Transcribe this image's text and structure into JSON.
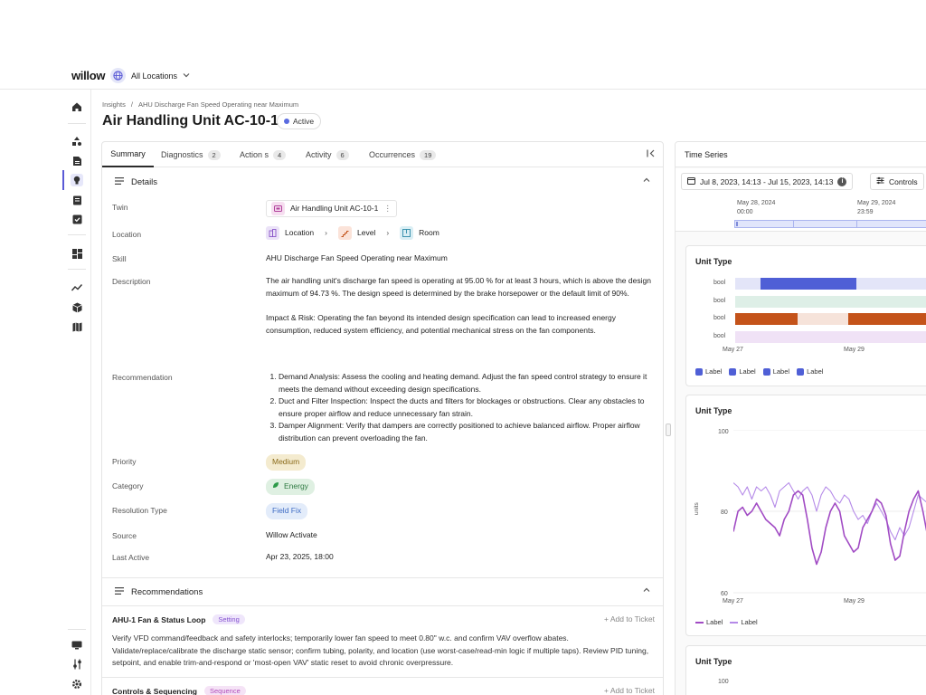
{
  "app": {
    "logo": "willow",
    "location_selector": "All Locations"
  },
  "breadcrumb": {
    "parent": "Insights",
    "separator": "/",
    "current": "AHU Discharge Fan Speed Operating near Maximum"
  },
  "page": {
    "title": "Air Handling Unit AC-10-1",
    "status": "Active"
  },
  "tabs": [
    {
      "label": "Summary",
      "count": ""
    },
    {
      "label": "Diagnostics",
      "count": "2"
    },
    {
      "label": "Action s",
      "count": "4"
    },
    {
      "label": "Activity",
      "count": "6"
    },
    {
      "label": "Occurrences",
      "count": "19"
    }
  ],
  "details": {
    "heading": "Details",
    "twin_label": "Twin",
    "twin_value": "Air Handling Unit AC-10-1",
    "location_label": "Location",
    "location_path": [
      "Location",
      "Level",
      "Room"
    ],
    "skill_label": "Skill",
    "skill_value": "AHU Discharge Fan Speed Operating near Maximum",
    "description_label": "Description",
    "description_p1": "The air handling unit's discharge fan speed is operating at 95.00 % for at least 3 hours, which is above the design maximum of 94.73 %. The design speed is determined by the brake horsepower or the default limit of 90%.",
    "description_p2": "Impact & Risk: Operating the fan beyond its intended design specification can lead to increased energy consumption, reduced system efficiency, and potential mechanical stress on the fan components.",
    "recommendation_label": "Recommendation",
    "recommendation_items": [
      "Demand Analysis: Assess the cooling and heating demand. Adjust the fan speed control strategy to ensure it meets the demand without exceeding design specifications.",
      "Duct and Filter Inspection: Inspect the ducts and filters for blockages or obstructions. Clear any obstacles to ensure proper airflow and reduce unnecessary fan strain.",
      "Damper Alignment: Verify that dampers are correctly positioned to achieve balanced airflow. Proper airflow distribution can prevent overloading the fan."
    ],
    "priority_label": "Priority",
    "priority_value": "Medium",
    "category_label": "Category",
    "category_value": "Energy",
    "resolution_label": "Resolution Type",
    "resolution_value": "Field Fix",
    "source_label": "Source",
    "source_value": "Willow Activate",
    "last_active_label": "Last Active",
    "last_active_value": "Apr 23, 2025, 18:00"
  },
  "recommendations": {
    "heading": "Recommendations",
    "items": [
      {
        "title": "AHU-1 Fan & Status Loop",
        "tag": "Setting",
        "action": "Add to Ticket",
        "body": "Verify VFD command/feedback and safety interlocks; temporarily lower fan speed to meet 0.80\" w.c. and confirm VAV overflow abates. Validate/replace/calibrate the discharge static sensor; confirm tubing, polarity, and location (use worst-case/read-min logic if multiple taps). Review PID tuning, setpoint, and enable trim-and-respond or 'most-open VAV' static reset to avoid chronic overpressure."
      },
      {
        "title": "Controls & Sequencing",
        "tag": "Sequence",
        "action": "Add to Ticket",
        "body": ""
      }
    ]
  },
  "time_series": {
    "heading": "Time Series",
    "date_range": "Jul 8, 2023, 14:13 - Jul 15, 2023, 14:13",
    "controls_label": "Controls",
    "overview_ticks": [
      {
        "date": "May 28, 2024",
        "time": "00:00"
      },
      {
        "date": "May 29, 2024",
        "time": "23:59"
      }
    ]
  },
  "colors": {
    "accent": "#5a5ad6",
    "blue_series": "#4f5fd6",
    "orange_series": "#c4531a",
    "purple_series": "#a14bc4",
    "lilac_series": "#b58ae8"
  },
  "chart_data": [
    {
      "type": "bool-timeline",
      "title": "Unit Type",
      "rows": [
        {
          "label": "bool",
          "segments": [
            [
              0,
              0.12,
              "off"
            ],
            [
              0.12,
              0.58,
              "on"
            ],
            [
              0.58,
              1,
              "off"
            ]
          ],
          "color": "#4f5fd6"
        },
        {
          "label": "bool",
          "segments": [
            [
              0,
              1,
              "off"
            ]
          ],
          "color": "#2e9a6a"
        },
        {
          "label": "bool",
          "segments": [
            [
              0,
              0.3,
              "on"
            ],
            [
              0.3,
              0.54,
              "off"
            ],
            [
              0.54,
              1,
              "on"
            ]
          ],
          "color": "#c4531a"
        },
        {
          "label": "bool",
          "segments": [
            [
              0,
              1,
              "off"
            ]
          ],
          "color": "#a14bc4"
        }
      ],
      "x_ticks": [
        "May 27",
        "May 29"
      ],
      "legend": [
        "Label",
        "Label",
        "Label",
        "Label"
      ]
    },
    {
      "type": "line",
      "title": "Unit Type",
      "ylabel": "units",
      "ylim": [
        60,
        100
      ],
      "y_ticks": [
        100,
        80,
        60
      ],
      "x_ticks": [
        "May 27",
        "May 29"
      ],
      "series": [
        {
          "name": "Label",
          "color": "#a14bc4",
          "values": [
            75,
            80,
            81,
            79,
            80,
            82,
            80,
            78,
            77,
            76,
            74,
            78,
            80,
            84,
            85,
            84,
            78,
            71,
            67,
            70,
            76,
            80,
            82,
            80,
            74,
            72,
            70,
            71,
            76,
            78,
            80,
            83,
            82,
            79,
            72,
            68,
            69,
            75,
            80,
            83,
            85,
            80,
            74,
            75,
            83,
            88
          ]
        },
        {
          "name": "Label",
          "color": "#b58ae8",
          "values": [
            87,
            86,
            84,
            86,
            83,
            86,
            85,
            86,
            84,
            81,
            85,
            86,
            87,
            85,
            83,
            85,
            86,
            84,
            80,
            84,
            86,
            85,
            83,
            82,
            84,
            83,
            80,
            78,
            79,
            77,
            80,
            82,
            80,
            78,
            75,
            73,
            76,
            74,
            76,
            80,
            84,
            83,
            82,
            85,
            88,
            86
          ]
        }
      ]
    },
    {
      "type": "line",
      "title": "Unit Type",
      "y_ticks": [
        100
      ]
    }
  ]
}
